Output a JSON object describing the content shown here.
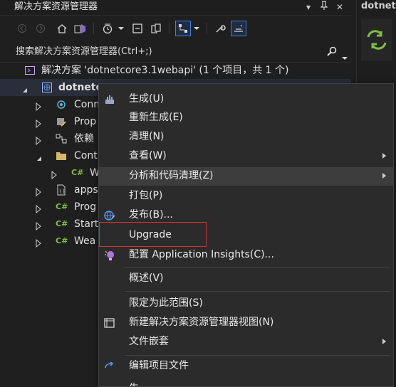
{
  "panel": {
    "title": "解决方案资源管理器",
    "pin_glyph": "▾ ⊥",
    "close_glyph": "✕"
  },
  "editor_tab": {
    "title": "dotnet"
  },
  "search": {
    "placeholder": "搜索解决方案资源管理器(Ctrl+;)"
  },
  "tree": {
    "solution": "解决方案 'dotnetcore3.1webapi' (1 个项目，共 1 个)",
    "project": "dotnetc",
    "items": [
      {
        "label": "Conn",
        "icon": "connected-services-icon",
        "indent": 1,
        "expanded": false
      },
      {
        "label": "Prop",
        "icon": "properties-wrench-icon",
        "indent": 1,
        "expanded": false
      },
      {
        "label": "依赖",
        "icon": "dependencies-icon",
        "indent": 1,
        "expanded": false
      },
      {
        "label": "Cont",
        "icon": "folder-icon",
        "indent": 1,
        "expanded": true
      },
      {
        "label": "W",
        "icon": "csharp-file-icon",
        "indent": 2,
        "expanded": false
      },
      {
        "label": "apps",
        "icon": "json-file-icon",
        "indent": 1,
        "expanded": false
      },
      {
        "label": "Prog",
        "icon": "csharp-file-icon",
        "indent": 1,
        "expanded": false
      },
      {
        "label": "Start",
        "icon": "csharp-file-icon",
        "indent": 1,
        "expanded": false
      },
      {
        "label": "Wea",
        "icon": "csharp-file-icon",
        "indent": 1,
        "expanded": false
      }
    ]
  },
  "menu": {
    "items": [
      {
        "label": "生成(U)",
        "icon": "build-icon",
        "submenu": false
      },
      {
        "label": "重新生成(E)",
        "icon": "",
        "submenu": false
      },
      {
        "label": "清理(N)",
        "icon": "",
        "submenu": false
      },
      {
        "label": "查看(W)",
        "icon": "",
        "submenu": true
      },
      {
        "label": "分析和代码清理(Z)",
        "icon": "",
        "submenu": true
      },
      {
        "label": "打包(P)",
        "icon": "",
        "submenu": false
      },
      {
        "label": "发布(B)...",
        "icon": "publish-globe-icon",
        "submenu": false
      },
      {
        "label": "Upgrade",
        "icon": "",
        "submenu": false
      },
      {
        "label": "配置 Application Insights(C)...",
        "icon": "application-insights-icon",
        "submenu": false
      },
      {
        "label": "概述(V)",
        "icon": "",
        "submenu": false
      },
      {
        "label": "限定为此范围(S)",
        "icon": "",
        "submenu": false
      },
      {
        "label": "新建解决方案资源管理器视图(N)",
        "icon": "new-view-icon",
        "submenu": false
      },
      {
        "label": "文件嵌套",
        "icon": "",
        "submenu": true
      },
      {
        "label": "编辑项目文件",
        "icon": "edit-project-icon",
        "submenu": false
      },
      {
        "label": "生",
        "icon": "",
        "submenu": false
      }
    ],
    "highlighted": "分析和代码清理(Z)",
    "callout": "Upgrade",
    "callout_color": "#d23434"
  },
  "colors": {
    "background": "#1f1f1f",
    "menu_background": "#2b2b2b",
    "accent": "#3f7fd8",
    "csharp": "#7fbf3f",
    "vs_purple": "#8f63d8"
  }
}
